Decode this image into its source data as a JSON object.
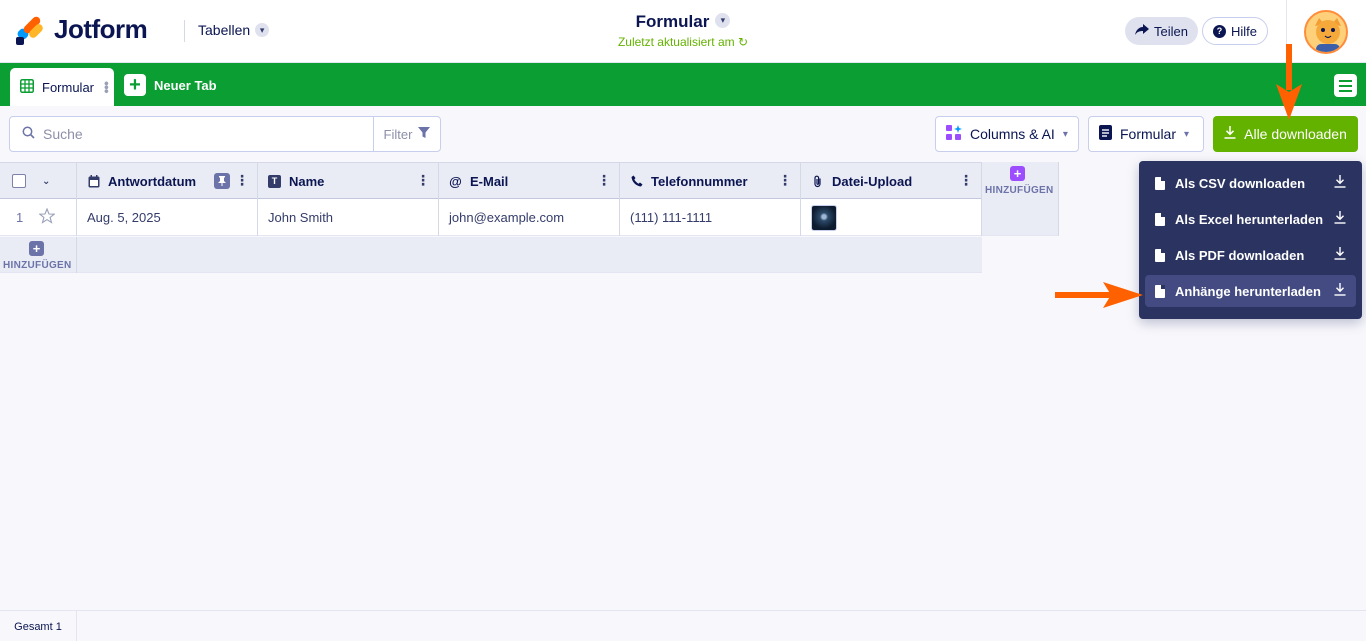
{
  "header": {
    "brand": "Jotform",
    "section_menu": "Tabellen",
    "form_title": "Formular",
    "updated_text": "Zuletzt aktualisiert am",
    "share_label": "Teilen",
    "help_label": "Hilfe"
  },
  "tabbar": {
    "active_tab": "Formular",
    "new_tab_label": "Neuer Tab"
  },
  "toolbar": {
    "search_placeholder": "Suche",
    "filter_label": "Filter",
    "columns_ai_label": "Columns & AI",
    "view_label": "Formular",
    "download_all_label": "Alle downloaden"
  },
  "table": {
    "columns": [
      {
        "label": "Antwortdatum",
        "icon": "calendar-icon"
      },
      {
        "label": "Name",
        "icon": "text-icon"
      },
      {
        "label": "E-Mail",
        "icon": "at-icon"
      },
      {
        "label": "Telefonnummer",
        "icon": "phone-icon"
      },
      {
        "label": "Datei-Upload",
        "icon": "paperclip-icon"
      }
    ],
    "add_column_label": "HINZUFÜGEN",
    "add_row_label": "HINZUFÜGEN",
    "rows": [
      {
        "index": "1",
        "date": "Aug. 5, 2025",
        "name": "John Smith",
        "email": "john@example.com",
        "phone": "(111) 111-1111",
        "upload": "image-thumbnail"
      }
    ]
  },
  "download_menu": {
    "items": [
      {
        "label": "Als CSV downloaden",
        "icon": "csv-file-icon"
      },
      {
        "label": "Als Excel herunterladen",
        "icon": "xls-file-icon"
      },
      {
        "label": "Als PDF downloaden",
        "icon": "pdf-file-icon"
      },
      {
        "label": "Anhänge herunterladen",
        "icon": "attachment-file-icon",
        "highlighted": true
      }
    ]
  },
  "footer": {
    "total_label": "Gesamt",
    "total_count": "1"
  },
  "colors": {
    "brand_green": "#0b9e32",
    "download_green": "#64b200",
    "navy": "#0a1551",
    "menu_bg": "#2b3360",
    "annotation_orange": "#ff6100"
  }
}
